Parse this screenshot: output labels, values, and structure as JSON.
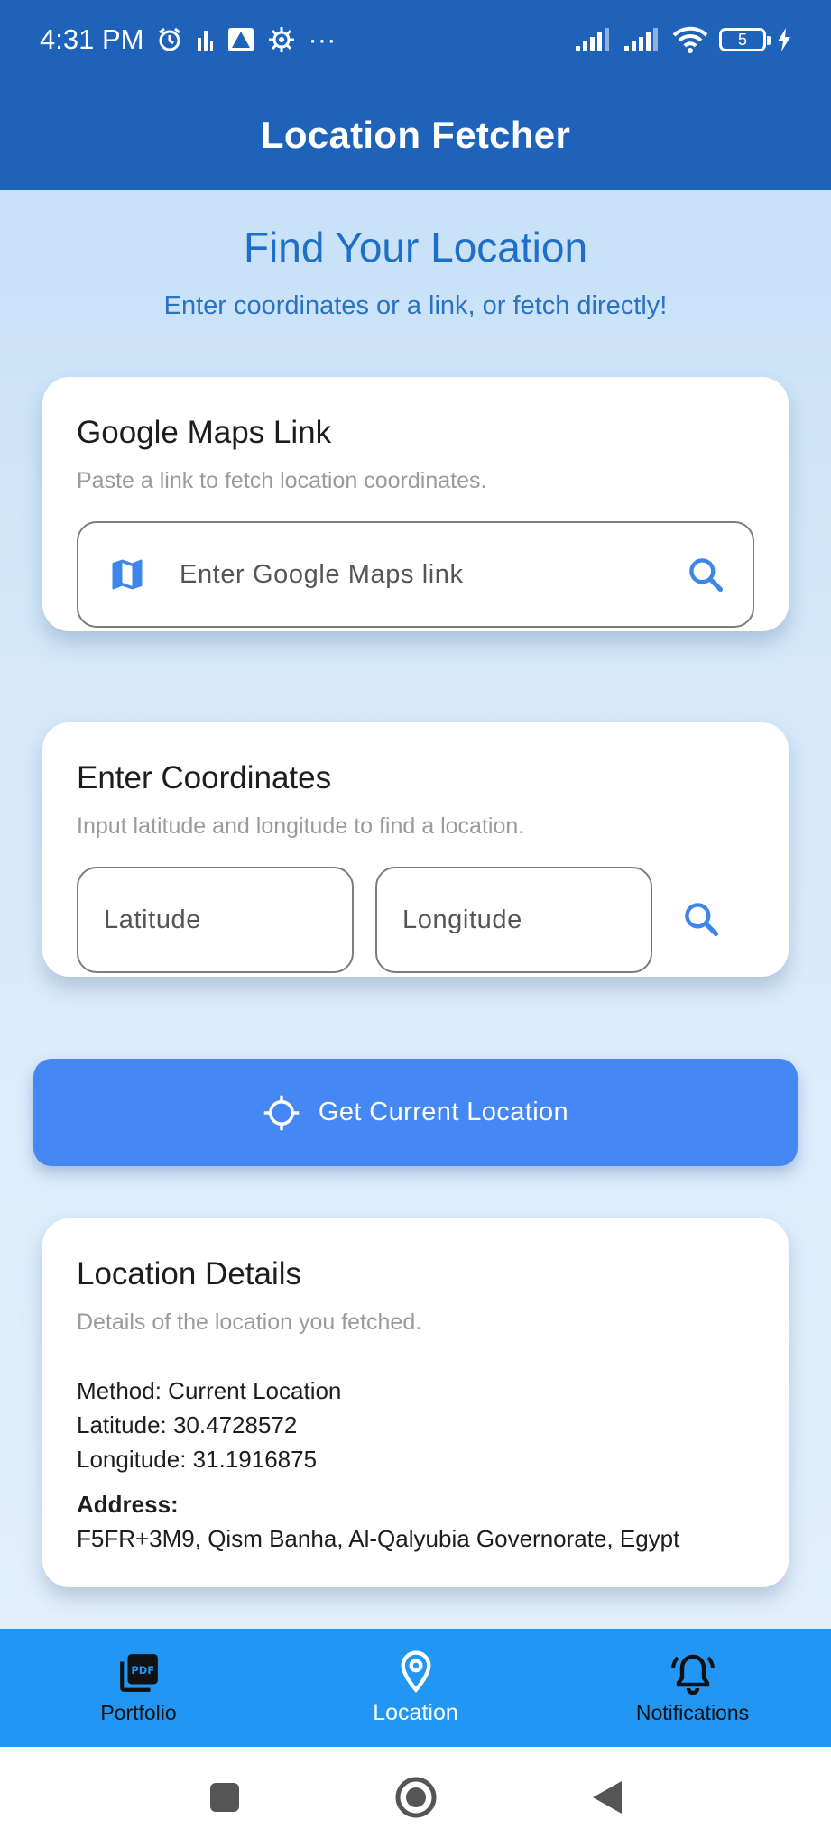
{
  "status_bar": {
    "time": "4:31 PM",
    "battery_level": "5",
    "more_indicator": "···"
  },
  "app_bar": {
    "title": "Location Fetcher"
  },
  "hero": {
    "title": "Find Your Location",
    "subtitle": "Enter coordinates or a link, or fetch directly!"
  },
  "maps_link_card": {
    "title": "Google Maps Link",
    "subtitle": "Paste a link to fetch location coordinates.",
    "input_placeholder": "Enter Google Maps link",
    "input_value": ""
  },
  "coordinates_card": {
    "title": "Enter Coordinates",
    "subtitle": "Input latitude and longitude to find a location.",
    "latitude_placeholder": "Latitude",
    "longitude_placeholder": "Longitude"
  },
  "current_location_button": {
    "label": "Get Current Location"
  },
  "details_card": {
    "title": "Location Details",
    "subtitle": "Details of the location you fetched.",
    "method": "Method: Current Location",
    "latitude": "Latitude: 30.4728572",
    "longitude": "Longitude: 31.1916875",
    "address_label": "Address:",
    "address_value": "F5FR+3M9, Qism Banha, Al-Qalyubia Governorate, Egypt"
  },
  "bottom_nav": {
    "items": [
      {
        "label": "Portfolio",
        "icon": "pdf-icon",
        "active": false
      },
      {
        "label": "Location",
        "icon": "location-pin-icon",
        "active": true
      },
      {
        "label": "Notifications",
        "icon": "bell-ringing-icon",
        "active": false
      }
    ]
  },
  "colors": {
    "app_bar": "#1e63b9",
    "accent": "#4688f3",
    "bottom_nav": "#2196f3",
    "hero_text": "#1e6fc8"
  }
}
